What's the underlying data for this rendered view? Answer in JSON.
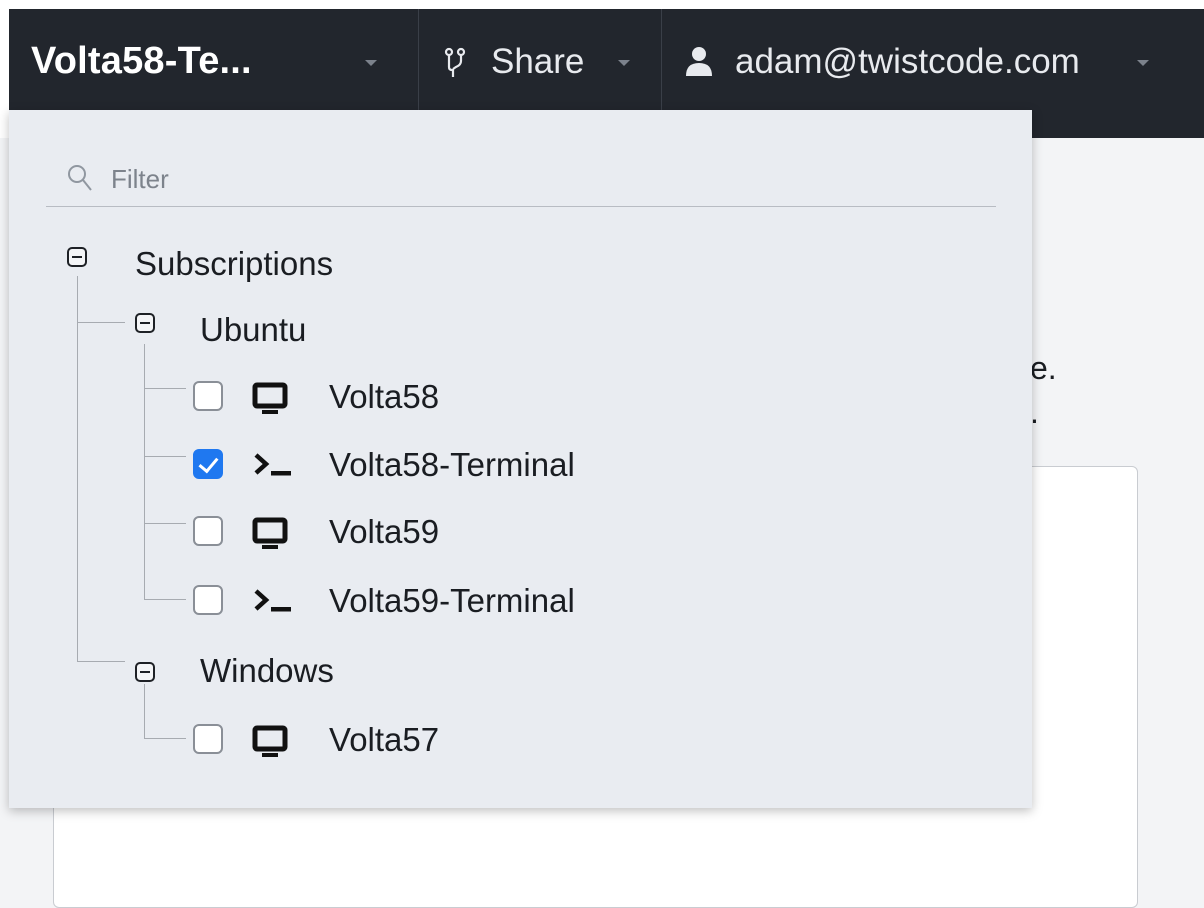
{
  "header": {
    "session_title": "Volta58-Te...",
    "share_label": "Share",
    "user_email": "adam@twistcode.com",
    "icons": {
      "share": "branch-share-icon",
      "user": "user-icon",
      "caret": "caret-down-icon"
    }
  },
  "background_text": {
    "line1_fragment": "e.",
    "line2_fragment": "."
  },
  "dropdown": {
    "filter": {
      "placeholder": "Filter",
      "value": "",
      "icon": "search-icon"
    },
    "tree": {
      "root_label": "Subscriptions",
      "groups": [
        {
          "label": "Ubuntu",
          "items": [
            {
              "label": "Volta58",
              "type": "desktop",
              "checked": false,
              "icon": "monitor-icon"
            },
            {
              "label": "Volta58-Terminal",
              "type": "terminal",
              "checked": true,
              "icon": "terminal-icon"
            },
            {
              "label": "Volta59",
              "type": "desktop",
              "checked": false,
              "icon": "monitor-icon"
            },
            {
              "label": "Volta59-Terminal",
              "type": "terminal",
              "checked": false,
              "icon": "terminal-icon"
            }
          ]
        },
        {
          "label": "Windows",
          "items": [
            {
              "label": "Volta57",
              "type": "desktop",
              "checked": false,
              "icon": "monitor-icon"
            }
          ]
        }
      ]
    }
  },
  "colors": {
    "header_bg": "#22262d",
    "dropdown_bg": "#e9ecf1",
    "checkbox_checked": "#1f78f0",
    "tree_line": "#a7abb1"
  }
}
